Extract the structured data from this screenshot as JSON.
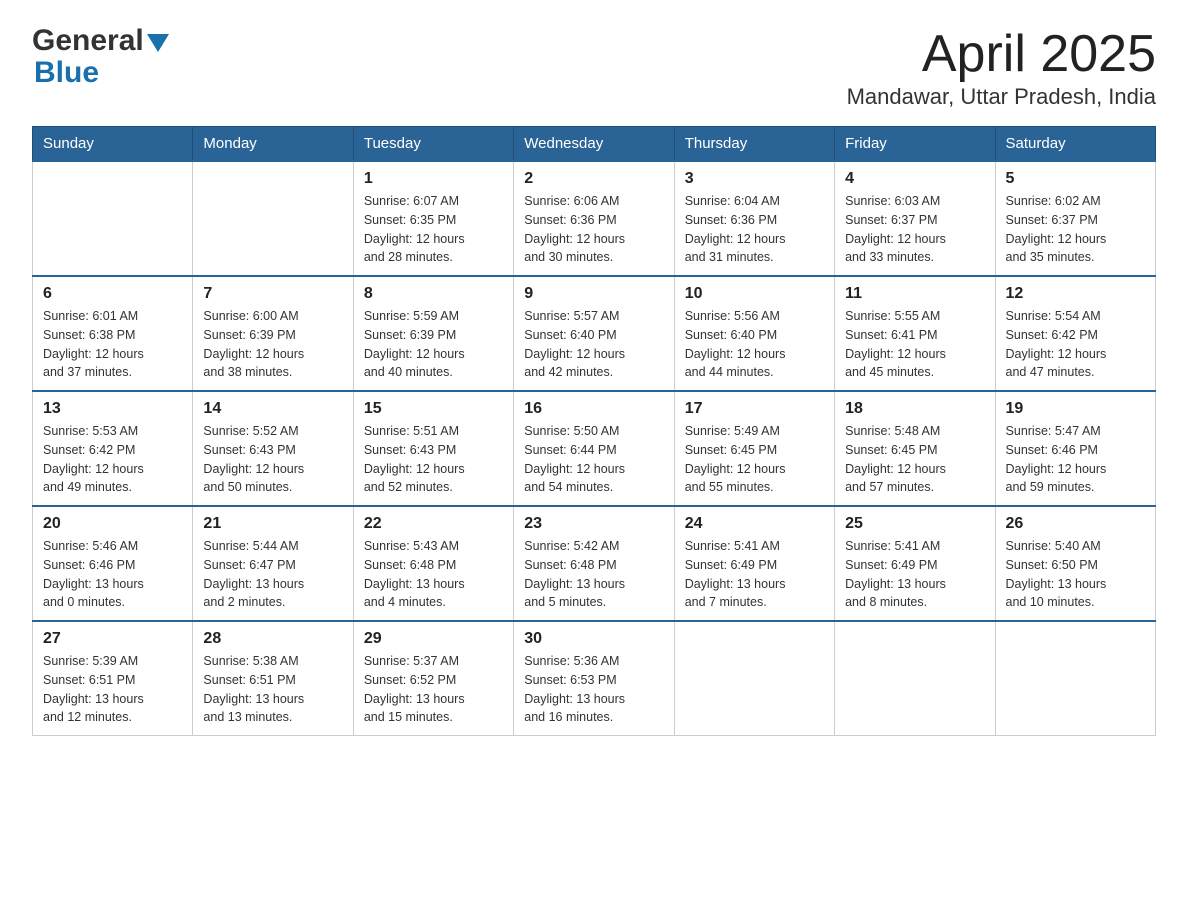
{
  "header": {
    "logo_general": "General",
    "logo_blue": "Blue",
    "title": "April 2025",
    "subtitle": "Mandawar, Uttar Pradesh, India"
  },
  "calendar": {
    "days_of_week": [
      "Sunday",
      "Monday",
      "Tuesday",
      "Wednesday",
      "Thursday",
      "Friday",
      "Saturday"
    ],
    "weeks": [
      [
        {
          "day": "",
          "info": ""
        },
        {
          "day": "",
          "info": ""
        },
        {
          "day": "1",
          "info": "Sunrise: 6:07 AM\nSunset: 6:35 PM\nDaylight: 12 hours\nand 28 minutes."
        },
        {
          "day": "2",
          "info": "Sunrise: 6:06 AM\nSunset: 6:36 PM\nDaylight: 12 hours\nand 30 minutes."
        },
        {
          "day": "3",
          "info": "Sunrise: 6:04 AM\nSunset: 6:36 PM\nDaylight: 12 hours\nand 31 minutes."
        },
        {
          "day": "4",
          "info": "Sunrise: 6:03 AM\nSunset: 6:37 PM\nDaylight: 12 hours\nand 33 minutes."
        },
        {
          "day": "5",
          "info": "Sunrise: 6:02 AM\nSunset: 6:37 PM\nDaylight: 12 hours\nand 35 minutes."
        }
      ],
      [
        {
          "day": "6",
          "info": "Sunrise: 6:01 AM\nSunset: 6:38 PM\nDaylight: 12 hours\nand 37 minutes."
        },
        {
          "day": "7",
          "info": "Sunrise: 6:00 AM\nSunset: 6:39 PM\nDaylight: 12 hours\nand 38 minutes."
        },
        {
          "day": "8",
          "info": "Sunrise: 5:59 AM\nSunset: 6:39 PM\nDaylight: 12 hours\nand 40 minutes."
        },
        {
          "day": "9",
          "info": "Sunrise: 5:57 AM\nSunset: 6:40 PM\nDaylight: 12 hours\nand 42 minutes."
        },
        {
          "day": "10",
          "info": "Sunrise: 5:56 AM\nSunset: 6:40 PM\nDaylight: 12 hours\nand 44 minutes."
        },
        {
          "day": "11",
          "info": "Sunrise: 5:55 AM\nSunset: 6:41 PM\nDaylight: 12 hours\nand 45 minutes."
        },
        {
          "day": "12",
          "info": "Sunrise: 5:54 AM\nSunset: 6:42 PM\nDaylight: 12 hours\nand 47 minutes."
        }
      ],
      [
        {
          "day": "13",
          "info": "Sunrise: 5:53 AM\nSunset: 6:42 PM\nDaylight: 12 hours\nand 49 minutes."
        },
        {
          "day": "14",
          "info": "Sunrise: 5:52 AM\nSunset: 6:43 PM\nDaylight: 12 hours\nand 50 minutes."
        },
        {
          "day": "15",
          "info": "Sunrise: 5:51 AM\nSunset: 6:43 PM\nDaylight: 12 hours\nand 52 minutes."
        },
        {
          "day": "16",
          "info": "Sunrise: 5:50 AM\nSunset: 6:44 PM\nDaylight: 12 hours\nand 54 minutes."
        },
        {
          "day": "17",
          "info": "Sunrise: 5:49 AM\nSunset: 6:45 PM\nDaylight: 12 hours\nand 55 minutes."
        },
        {
          "day": "18",
          "info": "Sunrise: 5:48 AM\nSunset: 6:45 PM\nDaylight: 12 hours\nand 57 minutes."
        },
        {
          "day": "19",
          "info": "Sunrise: 5:47 AM\nSunset: 6:46 PM\nDaylight: 12 hours\nand 59 minutes."
        }
      ],
      [
        {
          "day": "20",
          "info": "Sunrise: 5:46 AM\nSunset: 6:46 PM\nDaylight: 13 hours\nand 0 minutes."
        },
        {
          "day": "21",
          "info": "Sunrise: 5:44 AM\nSunset: 6:47 PM\nDaylight: 13 hours\nand 2 minutes."
        },
        {
          "day": "22",
          "info": "Sunrise: 5:43 AM\nSunset: 6:48 PM\nDaylight: 13 hours\nand 4 minutes."
        },
        {
          "day": "23",
          "info": "Sunrise: 5:42 AM\nSunset: 6:48 PM\nDaylight: 13 hours\nand 5 minutes."
        },
        {
          "day": "24",
          "info": "Sunrise: 5:41 AM\nSunset: 6:49 PM\nDaylight: 13 hours\nand 7 minutes."
        },
        {
          "day": "25",
          "info": "Sunrise: 5:41 AM\nSunset: 6:49 PM\nDaylight: 13 hours\nand 8 minutes."
        },
        {
          "day": "26",
          "info": "Sunrise: 5:40 AM\nSunset: 6:50 PM\nDaylight: 13 hours\nand 10 minutes."
        }
      ],
      [
        {
          "day": "27",
          "info": "Sunrise: 5:39 AM\nSunset: 6:51 PM\nDaylight: 13 hours\nand 12 minutes."
        },
        {
          "day": "28",
          "info": "Sunrise: 5:38 AM\nSunset: 6:51 PM\nDaylight: 13 hours\nand 13 minutes."
        },
        {
          "day": "29",
          "info": "Sunrise: 5:37 AM\nSunset: 6:52 PM\nDaylight: 13 hours\nand 15 minutes."
        },
        {
          "day": "30",
          "info": "Sunrise: 5:36 AM\nSunset: 6:53 PM\nDaylight: 13 hours\nand 16 minutes."
        },
        {
          "day": "",
          "info": ""
        },
        {
          "day": "",
          "info": ""
        },
        {
          "day": "",
          "info": ""
        }
      ]
    ]
  }
}
